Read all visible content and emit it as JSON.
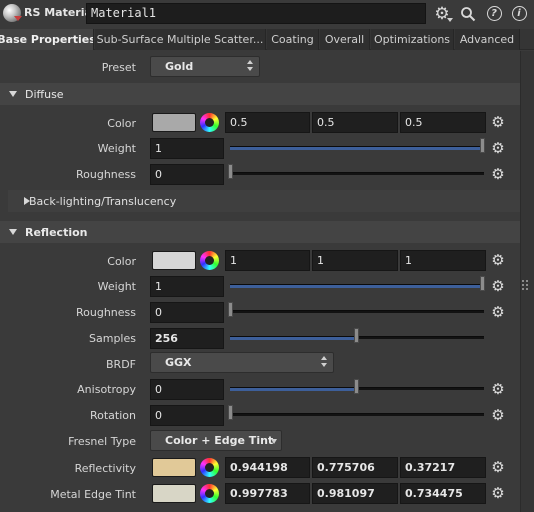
{
  "header": {
    "node_type": "RS Material",
    "node_name": "Material1",
    "icons": [
      "gear-icon",
      "search-icon",
      "help-icon",
      "info-icon"
    ],
    "help_glyph": "?",
    "info_glyph": "i"
  },
  "tabs": [
    {
      "label": "Base Properties",
      "active": true
    },
    {
      "label": "Sub-Surface Multiple Scatter..."
    },
    {
      "label": "Coating"
    },
    {
      "label": "Overall"
    },
    {
      "label": "Optimizations"
    },
    {
      "label": "Advanced"
    }
  ],
  "preset": {
    "label": "Preset",
    "value": "Gold"
  },
  "diffuse": {
    "title": "Diffuse",
    "color": {
      "label": "Color",
      "swatch": "#a9a9a9",
      "values": [
        "0.5",
        "0.5",
        "0.5"
      ]
    },
    "weight": {
      "label": "Weight",
      "value": "1",
      "level": 1.0
    },
    "roughness": {
      "label": "Roughness",
      "value": "0",
      "level": 0.0
    }
  },
  "backlighting": {
    "title": "Back-lighting/Translucency"
  },
  "reflection": {
    "title": "Reflection",
    "color": {
      "label": "Color",
      "swatch": "#d6d6d6",
      "values": [
        "1",
        "1",
        "1"
      ]
    },
    "weight": {
      "label": "Weight",
      "value": "1",
      "level": 1.0
    },
    "roughness": {
      "label": "Roughness",
      "value": "0",
      "level": 0.0
    },
    "samples": {
      "label": "Samples",
      "value": "256",
      "level": 0.5
    },
    "brdf": {
      "label": "BRDF",
      "value": "GGX"
    },
    "anisotropy": {
      "label": "Anisotropy",
      "value": "0",
      "level": 0.5
    },
    "rotation": {
      "label": "Rotation",
      "value": "0",
      "level": 0.0
    },
    "fresnel_type": {
      "label": "Fresnel Type",
      "value": "Color + Edge Tint"
    },
    "reflectivity": {
      "label": "Reflectivity",
      "swatch": "#e1c998",
      "values": [
        "0.944198",
        "0.775706",
        "0.37217"
      ]
    },
    "metal_edge_tint": {
      "label": "Metal Edge Tint",
      "swatch": "#d8d6c6",
      "values": [
        "0.997783",
        "0.981097",
        "0.734475"
      ]
    }
  },
  "colors": {
    "accent": "#3d5f9a",
    "background": "#3a3a3a",
    "field": "#1f1f1f"
  }
}
